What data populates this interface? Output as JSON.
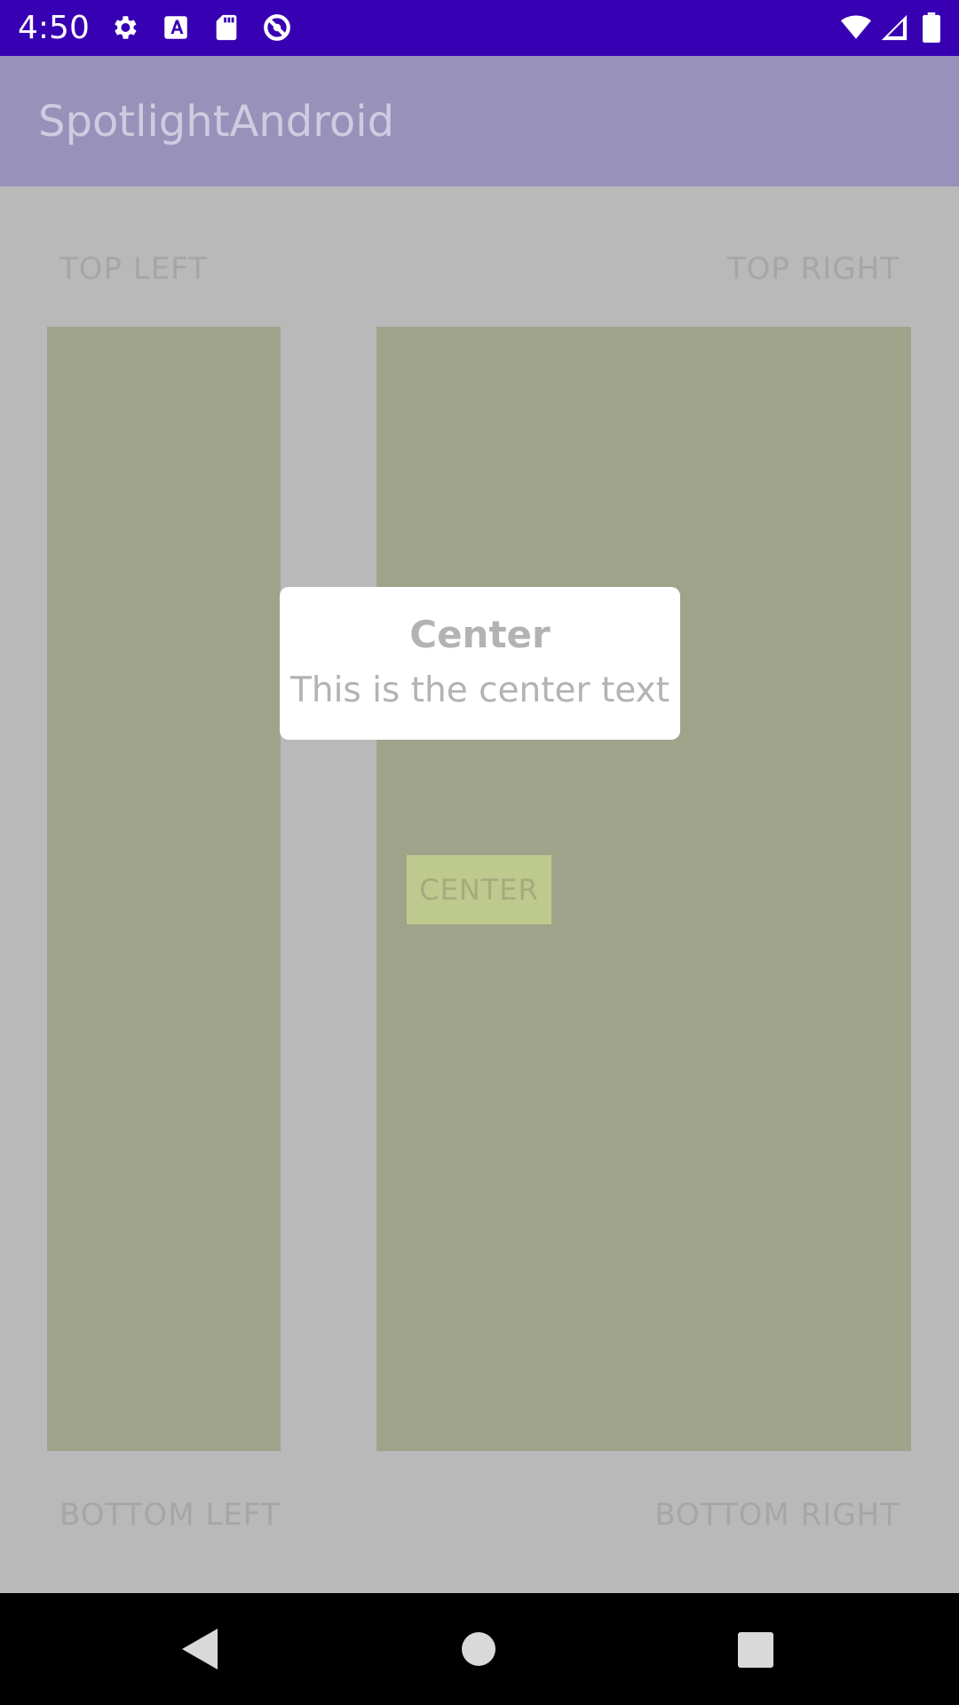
{
  "status_bar": {
    "time": "4:50",
    "icons": [
      "settings-icon",
      "a-box-icon",
      "sd-card-icon",
      "no-disturb-icon",
      "wifi-icon",
      "signal-icon",
      "battery-icon"
    ],
    "background": "#3700b3"
  },
  "app_bar": {
    "title": "SpotlightAndroid",
    "background": "#9891ba"
  },
  "labels": {
    "top_left": "TOP LEFT",
    "top_right": "TOP RIGHT",
    "bottom_left": "BOTTOM LEFT",
    "bottom_right": "BOTTOM RIGHT"
  },
  "center_button": {
    "label": "CENTER"
  },
  "tooltip": {
    "title": "Center",
    "text": "This is the center text"
  },
  "nav_bar": {
    "buttons": [
      "back-icon",
      "home-icon",
      "recents-icon"
    ]
  },
  "colors": {
    "overlay": "#b9b9b9",
    "block": "#9ea38a",
    "button": "#bec98e"
  }
}
